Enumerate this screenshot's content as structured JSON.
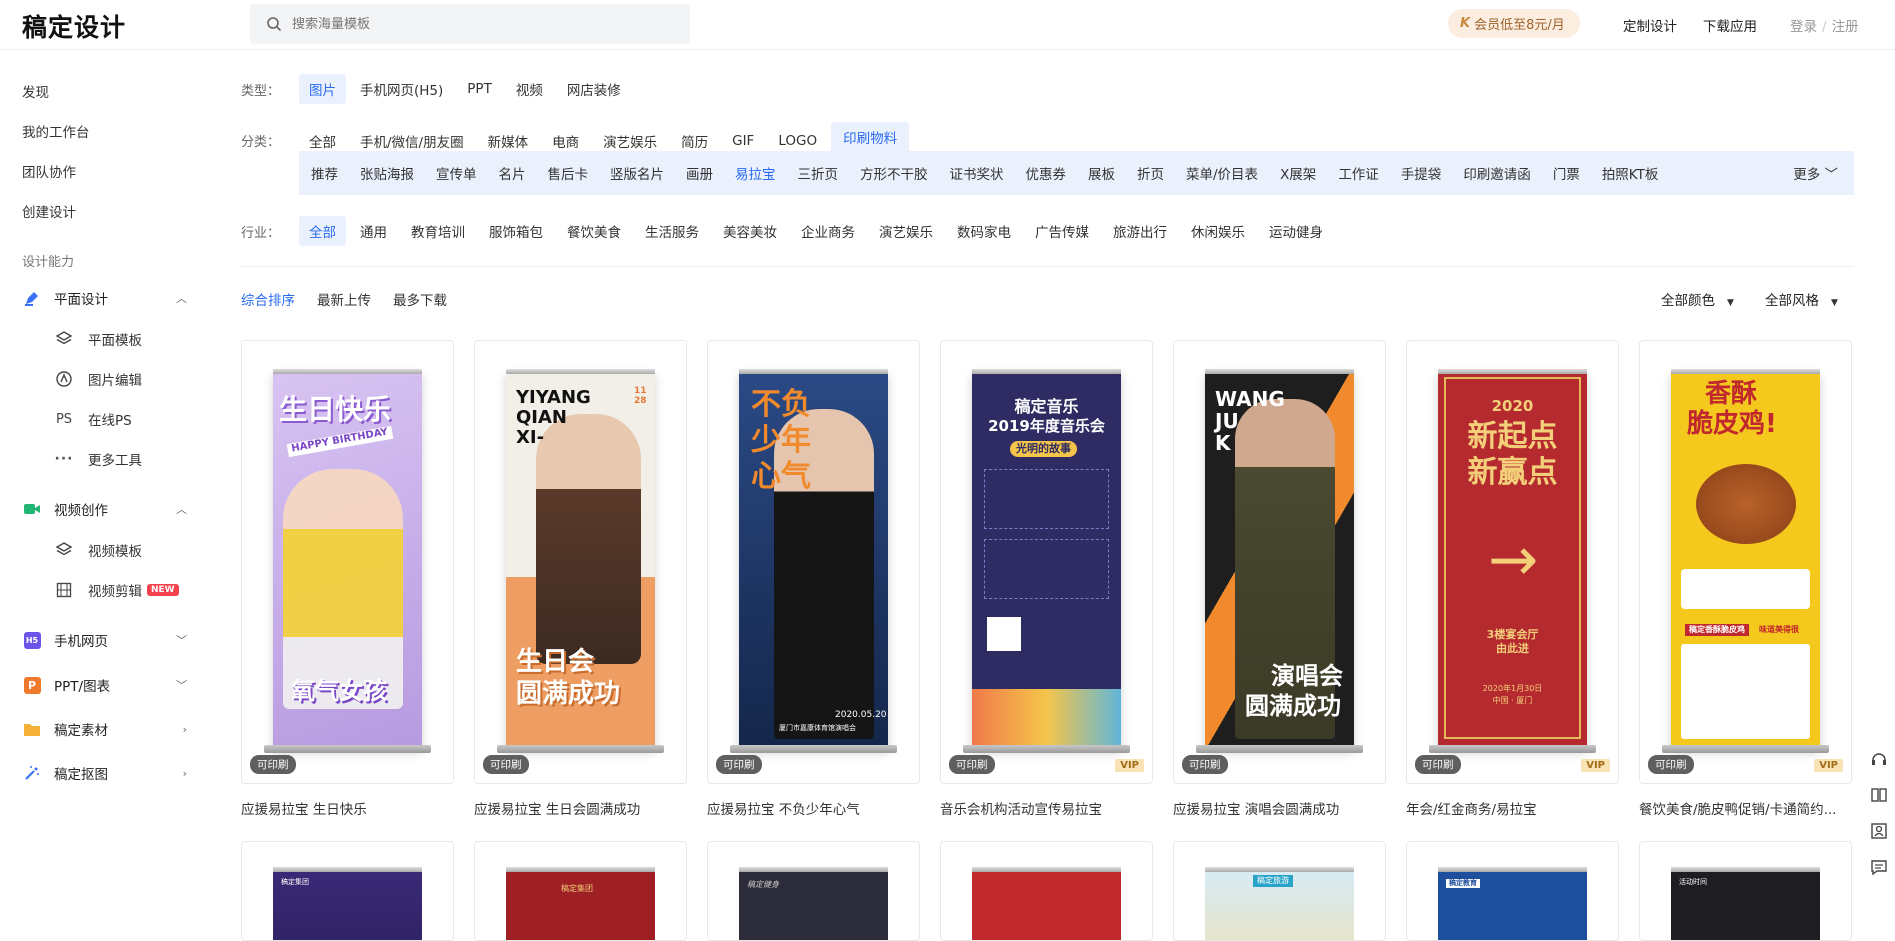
{
  "header": {
    "logo": "稿定设计",
    "search_placeholder": "搜索海量模板",
    "vip_icon": "K",
    "vip_text": "会员低至8元/月",
    "nav": [
      "定制设计",
      "下载应用"
    ],
    "login": "登录",
    "register": "注册"
  },
  "sidebar": {
    "top_items": [
      "发现",
      "我的工作台",
      "团队协作",
      "创建设计"
    ],
    "section_label": "设计能力",
    "groups": [
      {
        "label": "平面设计",
        "icon": "pen-icon",
        "expanded": true,
        "children": [
          {
            "label": "平面模板",
            "icon": "layers-icon"
          },
          {
            "label": "图片编辑",
            "icon": "edit-circle-icon"
          },
          {
            "label": "在线PS",
            "icon": "ps-icon"
          },
          {
            "label": "更多工具",
            "icon": "more-dots-icon"
          }
        ]
      },
      {
        "label": "视频创作",
        "icon": "video-icon",
        "expanded": true,
        "children": [
          {
            "label": "视频模板",
            "icon": "layers-icon"
          },
          {
            "label": "视频剪辑",
            "icon": "film-icon",
            "badge": "NEW"
          }
        ]
      },
      {
        "label": "手机网页",
        "icon": "h5-icon"
      },
      {
        "label": "PPT/图表",
        "icon": "ppt-icon"
      },
      {
        "label": "稿定素材",
        "icon": "folder-icon"
      },
      {
        "label": "稿定抠图",
        "icon": "magic-wand-icon"
      }
    ]
  },
  "filters": {
    "type_label": "类型：",
    "types": [
      "图片",
      "手机网页(H5)",
      "PPT",
      "视频",
      "网店装修"
    ],
    "type_active": 0,
    "category_label": "分类：",
    "categories": [
      "全部",
      "手机/微信/朋友圈",
      "新媒体",
      "电商",
      "演艺娱乐",
      "简历",
      "GIF",
      "LOGO",
      "印刷物料"
    ],
    "category_active": 8,
    "subcategories": [
      "推荐",
      "张贴海报",
      "宣传单",
      "名片",
      "售后卡",
      "竖版名片",
      "画册",
      "易拉宝",
      "三折页",
      "方形不干胶",
      "证书奖状",
      "优惠券",
      "展板",
      "折页",
      "菜单/价目表",
      "X展架",
      "工作证",
      "手提袋",
      "印刷邀请函",
      "门票",
      "拍照KT板"
    ],
    "subcategory_selected": 7,
    "more_label": "更多",
    "industry_label": "行业：",
    "industries": [
      "全部",
      "通用",
      "教育培训",
      "服饰箱包",
      "餐饮美食",
      "生活服务",
      "美容美妆",
      "企业商务",
      "演艺娱乐",
      "数码家电",
      "广告传媒",
      "旅游出行",
      "休闲娱乐",
      "运动健身"
    ],
    "industry_active": 0
  },
  "sort": {
    "options": [
      "综合排序",
      "最新上传",
      "最多下载"
    ],
    "active": 0,
    "color_filter": "全部颜色",
    "style_filter": "全部风格"
  },
  "cards": [
    {
      "title": "应援易拉宝 生日快乐",
      "badge": "可印刷",
      "vip": "",
      "bg": "#c9b3e6",
      "texts": [
        "生日快乐",
        "HAPPY BIRTHDAY",
        "氧气女孩"
      ]
    },
    {
      "title": "应援易拉宝 生日会圆满成功",
      "badge": "可印刷",
      "vip": "",
      "bg": "#e9a06a",
      "texts": [
        "YIYANG",
        "QIAN",
        "XI-",
        "11",
        "28",
        "生日会",
        "圆满成功"
      ]
    },
    {
      "title": "应援易拉宝 不负少年心气",
      "badge": "可印刷",
      "vip": "",
      "bg": "#1b2f57",
      "texts": [
        "不负",
        "少年",
        "心气",
        "2020.05.20",
        "厦门市嘉康体育馆演唱会"
      ]
    },
    {
      "title": "音乐会机构活动宣传易拉宝",
      "badge": "可印刷",
      "vip": "VIP",
      "bg": "#2f2c63",
      "texts": [
        "稿定音乐",
        "2019年度音乐会",
        "光明的故事"
      ]
    },
    {
      "title": "应援易拉宝 演唱会圆满成功",
      "badge": "可印刷",
      "vip": "",
      "bg": "#2a2a2a",
      "texts": [
        "WANG",
        "JU",
        "K",
        "演唱会",
        "圆满成功"
      ]
    },
    {
      "title": "年会/红金商务/易拉宝",
      "badge": "可印刷",
      "vip": "VIP",
      "bg": "#b52a2f",
      "texts": [
        "2020",
        "新起点",
        "新赢点",
        "3楼宴会厅",
        "由此进",
        "2020年1月30日",
        "中国 · 厦门"
      ]
    },
    {
      "title": "餐饮美食/脆皮鸭促销/卡通简约...",
      "badge": "可印刷",
      "vip": "VIP",
      "bg": "#f5c81e",
      "texts": [
        "香酥",
        "脆皮鸡!",
        "稿定香酥脆皮鸡",
        "味道美得很"
      ]
    }
  ],
  "cards_row2": [
    {
      "bg": "#2c1f5c",
      "text": "稿定集团"
    },
    {
      "bg": "#9e1f24",
      "text": "稿定集团"
    },
    {
      "bg": "#2b2b3a",
      "text": "稿定健身"
    },
    {
      "bg": "#c0282d",
      "text": ""
    },
    {
      "bg": "#d6ecf7",
      "text": "稿定旅游"
    },
    {
      "bg": "#1d4f9c",
      "text": "稿定教育"
    },
    {
      "bg": "#1e1e22",
      "text": "活动时间"
    }
  ]
}
